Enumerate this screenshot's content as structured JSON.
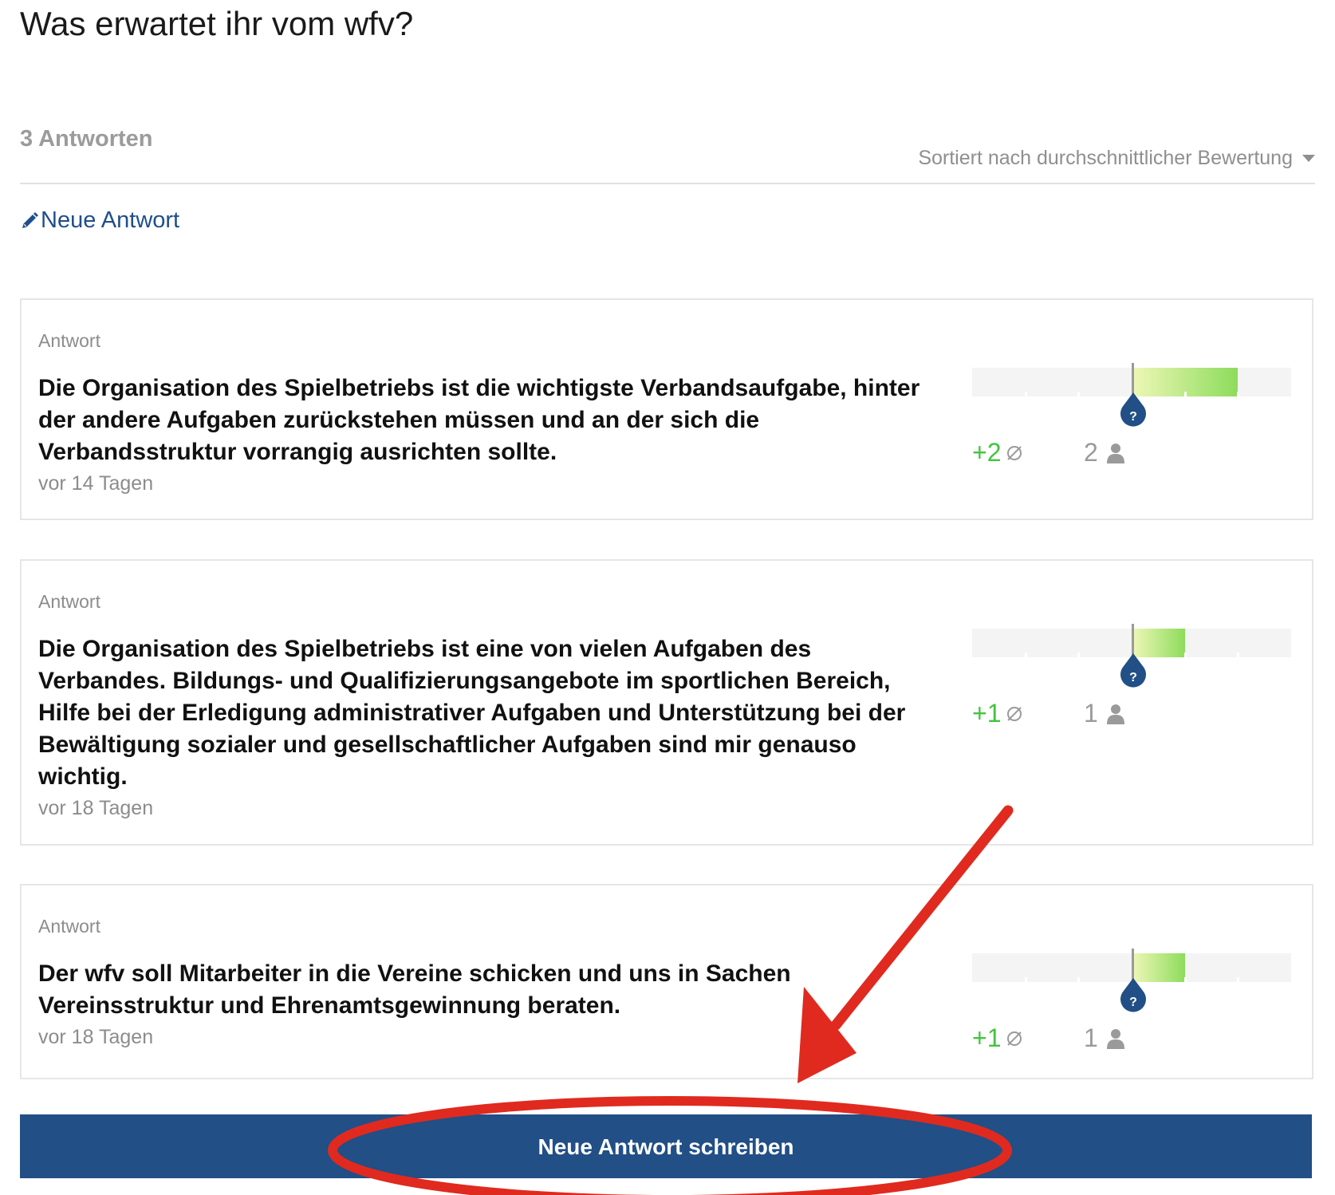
{
  "page": {
    "title": "Was erwartet ihr vom wfv?",
    "count_label": "3 Antworten",
    "sort_label": "Sortiert nach durchschnittlicher Bewertung",
    "new_answer_link": "Neue Antwort",
    "primary_button": "Neue Antwort schreiben"
  },
  "answers": [
    {
      "label": "Antwort",
      "text": "Die Organisation des Spielbetriebs ist die wichtigste Verbandsaufgabe, hinter der andere Aufgaben zurückstehen müssen und an der sich die Verbandsstruktur vorrangig ausrichten sollte.",
      "date": "vor 14 Tagen",
      "average": "+2",
      "average_value": 2,
      "voters": "2",
      "marker_symbol": "?"
    },
    {
      "label": "Antwort",
      "text": "Die Organisation des Spielbetriebs ist eine von vielen Aufgaben des Verbandes. Bildungs- und Qualifizierungsangebote im sportlichen Bereich, Hilfe bei der Erledigung administrativer Aufgaben und Unterstützung bei der Bewältigung sozialer und gesellschaftlicher Aufgaben sind mir genauso wichtig.",
      "date": "vor 18 Tagen",
      "average": "+1",
      "average_value": 1,
      "voters": "1",
      "marker_symbol": "?"
    },
    {
      "label": "Antwort",
      "text": "Der wfv soll Mitarbeiter in die Vereine schicken und uns in Sachen Vereinsstruktur und Ehrenamtsgewinnung beraten.",
      "date": "vor 18 Tagen",
      "average": "+1",
      "average_value": 1,
      "voters": "1",
      "marker_symbol": "?"
    }
  ],
  "rating_scale": {
    "min": -3,
    "max": 3
  },
  "icons": {
    "new_answer": "pencil-icon",
    "sort": "caret-down-icon",
    "average": "average-icon",
    "voters": "person-icon",
    "marker": "rating-marker-icon"
  },
  "colors": {
    "accent": "#214f86",
    "link": "#1f4e8c",
    "positive": "#43c43e",
    "muted": "#8c8c8c",
    "annotation": "#e02a1f"
  }
}
